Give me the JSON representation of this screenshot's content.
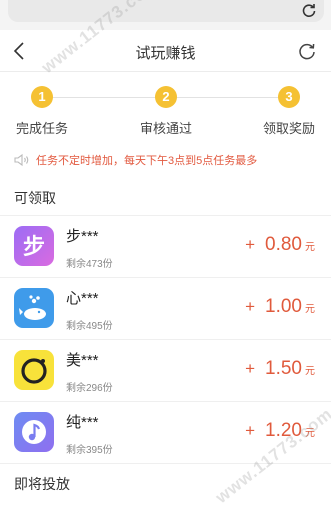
{
  "browser": {
    "icons": {
      "reload": "reload-icon"
    }
  },
  "header": {
    "title": "试玩赚钱",
    "icons": {
      "back": "chevron-left-icon",
      "refresh": "refresh-icon"
    }
  },
  "steps": [
    {
      "number": "1",
      "label": "完成任务"
    },
    {
      "number": "2",
      "label": "审核通过"
    },
    {
      "number": "3",
      "label": "领取奖励"
    }
  ],
  "notice": {
    "icon": "speaker-icon",
    "text": "任务不定时增加，每天下午3点到5点任务最多"
  },
  "sections": {
    "available": "可领取",
    "upcoming": "即将投放"
  },
  "tasks": [
    {
      "name": "步***",
      "remaining": "剩余473份",
      "plus": "+",
      "amount": "0.80",
      "unit": "元",
      "icon": "step-app-icon"
    },
    {
      "name": "心***",
      "remaining": "剩余495份",
      "plus": "+",
      "amount": "1.00",
      "unit": "元",
      "icon": "whale-app-icon"
    },
    {
      "name": "美***",
      "remaining": "剩余296份",
      "plus": "+",
      "amount": "1.50",
      "unit": "元",
      "icon": "camera-app-icon"
    },
    {
      "name": "纯***",
      "remaining": "剩余395份",
      "plus": "+",
      "amount": "1.20",
      "unit": "元",
      "icon": "music-note-app-icon"
    }
  ],
  "watermark": "www.11773.com",
  "colors": {
    "accent_red": "#e05a3c",
    "step_yellow": "#f5c133"
  }
}
